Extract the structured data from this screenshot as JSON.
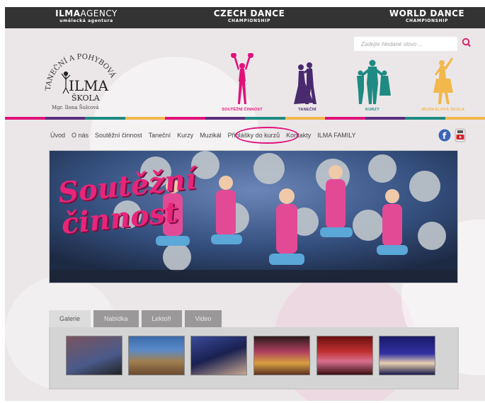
{
  "topbar": {
    "brand_left": {
      "bold": "ILMA",
      "light": "AGENCY",
      "sub": "umělecká agentura"
    },
    "brand_center": {
      "title": "CZECH DANCE",
      "sub": "CHAMPIONSHIP"
    },
    "brand_right": {
      "title": "WORLD DANCE",
      "sub": "CHAMPIONSHIP"
    }
  },
  "search": {
    "placeholder": "Zadejte hledané slovo ...",
    "icon": "search-icon"
  },
  "logo": {
    "arc": "TANEČNÍ A POHYBOVÁ",
    "main": "ILMA",
    "sub": "ŠKOLA",
    "author": "Mgr. Ilona Šulcová"
  },
  "categories": [
    {
      "label": "SOUTĚŽNÍ ČINNOST",
      "color": "#e0127a"
    },
    {
      "label": "TANEČNÍ",
      "color": "#4a2a6e"
    },
    {
      "label": "KURZY",
      "color": "#1f8a82"
    },
    {
      "label": "MUZIKÁLOVÁ ŠKOLA",
      "color": "#f2b84b"
    }
  ],
  "stripe_colors": [
    "#e0127a",
    "#5a2d7a",
    "#1f8a82",
    "#f2b84b",
    "#e0127a",
    "#5a2d7a",
    "#1f8a82",
    "#f2b84b",
    "#e0127a",
    "#5a2d7a",
    "#1f8a82",
    "#f2b84b"
  ],
  "nav": [
    "Úvod",
    "O nás",
    "Soutěžní činnost",
    "Taneční",
    "Kurzy",
    "Muzikál",
    "Přihlášky do kurzů",
    "Kontakty",
    "ILMA FAMILY"
  ],
  "nav_highlight_color": "#e0127a",
  "social": {
    "facebook": "facebook-icon",
    "youtube": "youtube-icon"
  },
  "banner": {
    "title": "Soutěžní\nčinnost"
  },
  "tabs": [
    "Galerie",
    "Nabídka",
    "Lektoři",
    "Video"
  ],
  "active_tab": "Galerie"
}
